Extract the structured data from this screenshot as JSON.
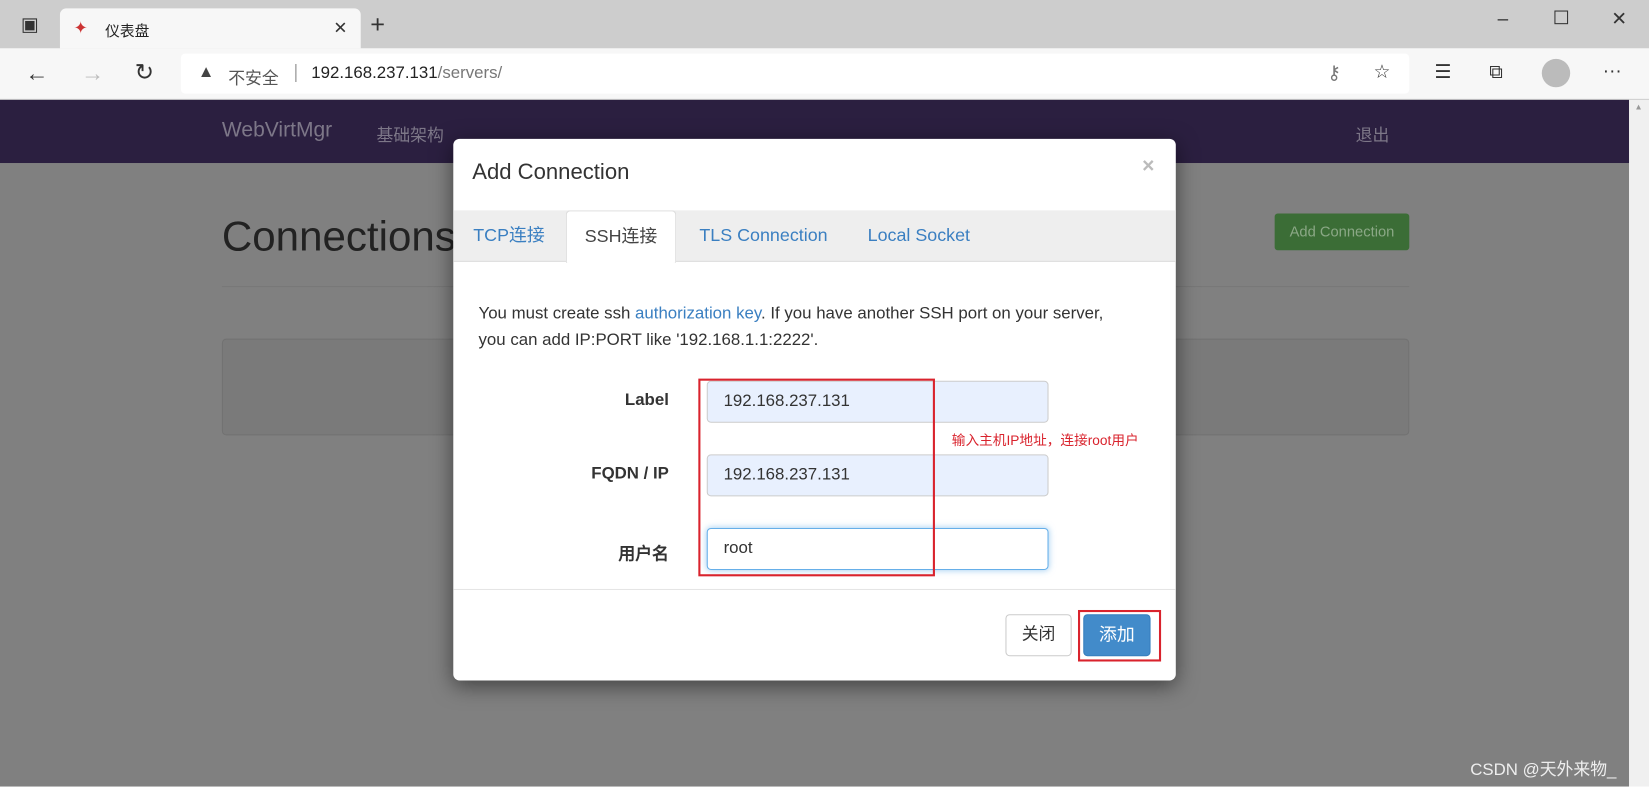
{
  "browser": {
    "tab_title": "仪表盘",
    "insecure_label": "不安全",
    "url_host": "192.168.237.131",
    "url_path": "/servers/"
  },
  "nav": {
    "brand": "WebVirtMgr",
    "infra": "基础架构",
    "logout": "退出"
  },
  "page": {
    "title": "Connections",
    "add_button": "Add Connection"
  },
  "modal": {
    "title": "Add Connection",
    "close": "×",
    "tabs": [
      {
        "label": "TCP连接"
      },
      {
        "label": "SSH连接",
        "active": true
      },
      {
        "label": "TLS Connection"
      },
      {
        "label": "Local Socket"
      }
    ],
    "help_pre": "You must create ssh ",
    "help_link": "authorization key",
    "help_post": ". If you have another SSH port on your server,",
    "help_line2": "you can add IP:PORT like '192.168.1.1:2222'.",
    "fields": [
      {
        "label": "Label",
        "value": "192.168.237.131"
      },
      {
        "label": "FQDN / IP",
        "value": "192.168.237.131"
      },
      {
        "label": "用户名",
        "value": "root"
      }
    ],
    "annotation": "输入主机IP地址，连接root用户",
    "close_button": "关闭",
    "add_button": "添加"
  },
  "watermark": "CSDN @天外来物_"
}
